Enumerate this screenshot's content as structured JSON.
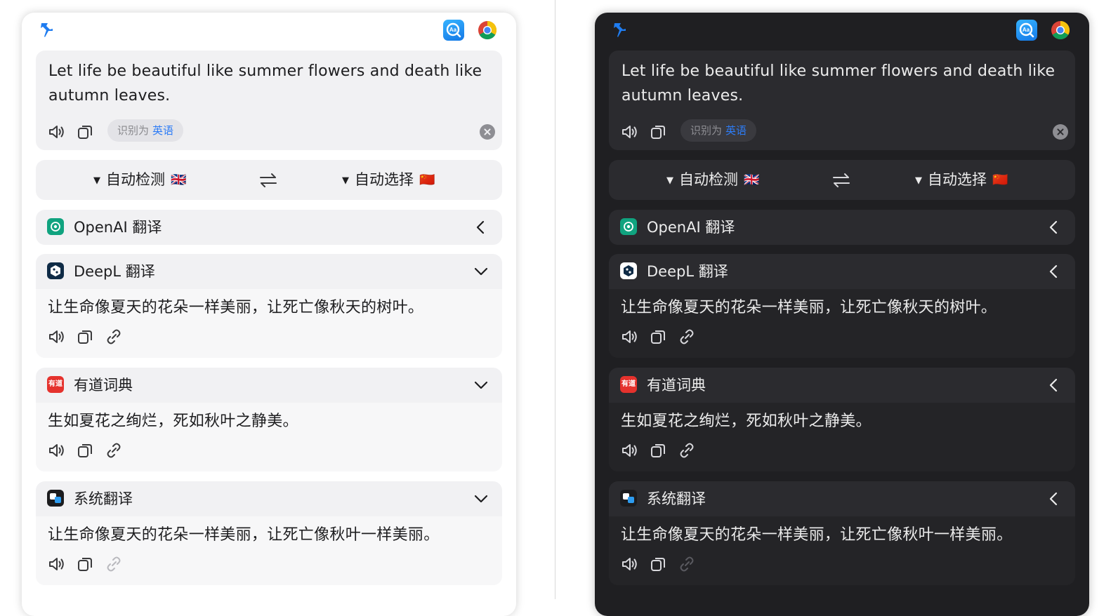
{
  "panels": [
    {
      "theme": "light",
      "input": {
        "text": "Let life be beautiful like summer flowers and death like autumn leaves.",
        "detected_prefix": "识别为",
        "detected_lang": "英语"
      },
      "languages": {
        "from_label": "自动检测",
        "from_flag": "🇬🇧",
        "to_label": "自动选择",
        "to_flag": "🇨🇳"
      },
      "services": [
        {
          "name": "OpenAI 翻译",
          "expanded": false,
          "result": "",
          "icon": "openai-icon"
        },
        {
          "name": "DeepL 翻译",
          "expanded": true,
          "result": "让生命像夏天的花朵一样美丽，让死亡像秋天的树叶。",
          "icon": "deepl-icon"
        },
        {
          "name": "有道词典",
          "expanded": true,
          "result": "生如夏花之绚烂，死如秋叶之静美。",
          "icon": "youdao-icon",
          "logo_text": "有道"
        },
        {
          "name": "系统翻译",
          "expanded": true,
          "result": "让生命像夏天的花朵一样美丽，让死亡像秋叶一样美丽。",
          "icon": "apple-translate-icon"
        }
      ]
    },
    {
      "theme": "dark",
      "input": {
        "text": "Let life be beautiful like summer flowers and death like autumn leaves.",
        "detected_prefix": "识别为",
        "detected_lang": "英语"
      },
      "languages": {
        "from_label": "自动检测",
        "from_flag": "🇬🇧",
        "to_label": "自动选择",
        "to_flag": "🇨🇳"
      },
      "services": [
        {
          "name": "OpenAI 翻译",
          "expanded": false,
          "result": "",
          "icon": "openai-icon"
        },
        {
          "name": "DeepL 翻译",
          "expanded": true,
          "result": "让生命像夏天的花朵一样美丽，让死亡像秋天的树叶。",
          "icon": "deepl-icon"
        },
        {
          "name": "有道词典",
          "expanded": true,
          "result": "生如夏花之绚烂，死如秋叶之静美。",
          "icon": "youdao-icon",
          "logo_text": "有道"
        },
        {
          "name": "系统翻译",
          "expanded": true,
          "result": "让生命像夏天的花朵一样美丽，让死亡像秋叶一样美丽。",
          "icon": "apple-translate-icon"
        }
      ]
    }
  ],
  "colors": {
    "accent": "#2d7cf6",
    "pin": "#1f7cf0",
    "light_bg": "#ffffff",
    "light_card": "#f1f1f3",
    "dark_bg": "#1f1f22",
    "dark_card": "#2b2b2f"
  },
  "icons": [
    "pin-icon",
    "dictionary-app-icon",
    "chrome-icon",
    "speaker-icon",
    "copy-icon",
    "link-icon",
    "clear-icon",
    "swap-icon",
    "chevron-left-icon",
    "chevron-down-icon"
  ]
}
